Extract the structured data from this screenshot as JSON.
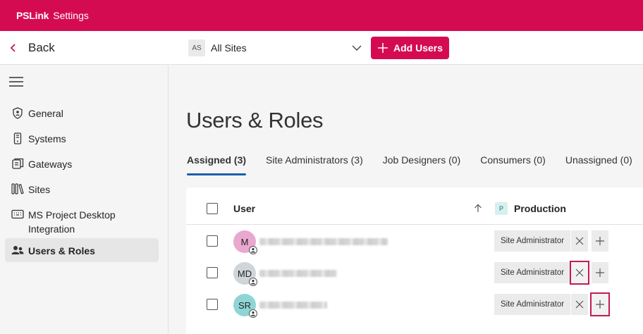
{
  "topbar": {
    "brand": "PSLink",
    "title": "Settings",
    "accent": "#d50b52"
  },
  "cmdbar": {
    "back_label": "Back",
    "site_picker": {
      "badge": "AS",
      "value": "All Sites"
    },
    "add_users_label": "Add Users"
  },
  "sidebar": {
    "items": [
      {
        "label": "General",
        "icon": "shield-icon"
      },
      {
        "label": "Systems",
        "icon": "device-icon"
      },
      {
        "label": "Gateways",
        "icon": "gateway-icon"
      },
      {
        "label": "Sites",
        "icon": "library-icon"
      },
      {
        "label": "MS Project Desktop Integration",
        "icon": "keyboard-icon"
      },
      {
        "label": "Users & Roles",
        "icon": "people-icon",
        "active": true
      }
    ]
  },
  "main": {
    "title": "Users & Roles",
    "tabs": [
      {
        "label": "Assigned (3)",
        "active": true
      },
      {
        "label": "Site Administrators (3)"
      },
      {
        "label": "Job Designers (0)"
      },
      {
        "label": "Consumers (0)"
      },
      {
        "label": "Unassigned (0)"
      }
    ],
    "grid": {
      "col_user": "User",
      "col_site_badge": "P",
      "col_site": "Production",
      "rows": [
        {
          "initials": "M",
          "avatar_color": "#e9a8cf",
          "role": "Site Administrator"
        },
        {
          "initials": "MD",
          "avatar_color": "#cfd5d8",
          "role": "Site Administrator"
        },
        {
          "initials": "SR",
          "avatar_color": "#8fd5d5",
          "role": "Site Administrator"
        }
      ]
    }
  }
}
